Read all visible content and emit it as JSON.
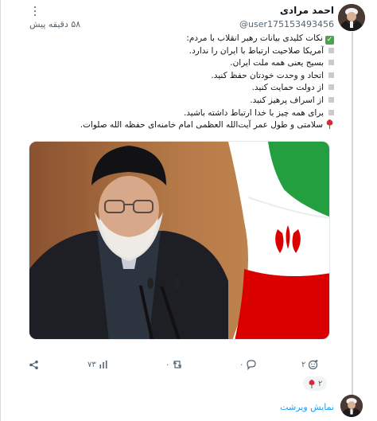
{
  "post": {
    "author_name": "احمد مرادی",
    "author_handle": "@user175153493456",
    "timestamp": "۵۸ دقیقه پیش",
    "lines": [
      "نکات کلیدی بیانات رهبر انقلاب با مردم:",
      "آمریکا صلاحیت ارتباط با ایران را ندارد.",
      "بسیج یعنی همه ملت ایران.",
      "اتحاد و وحدت خودتان حفظ کنید.",
      "از دولت حمایت کنید.",
      "از اسراف پرهیز کنید.",
      "برای همه چیز با خدا ارتباط داشته باشید.",
      "سلامتی و طول عمر آیت‌الله العظمی امام خامنه‌ای حفظه الله صلوات."
    ]
  },
  "actions": {
    "reactions_count": "۲",
    "reply_count": "۰",
    "repost_count": "۰",
    "views_count": "۷۳"
  },
  "reaction_chip": {
    "count": "۲"
  },
  "show_thread_label": "نمایش ویرشت",
  "colors": {
    "accent": "#1d9bf0",
    "check_green": "#4aa54a",
    "muted_text": "#536471",
    "flag_green": "#239f40",
    "flag_red": "#da0000"
  },
  "icons": [
    "more-vertical-icon",
    "check-icon",
    "rose-icon",
    "add-reaction-icon",
    "reply-icon",
    "repost-icon",
    "views-icon",
    "share-icon"
  ]
}
